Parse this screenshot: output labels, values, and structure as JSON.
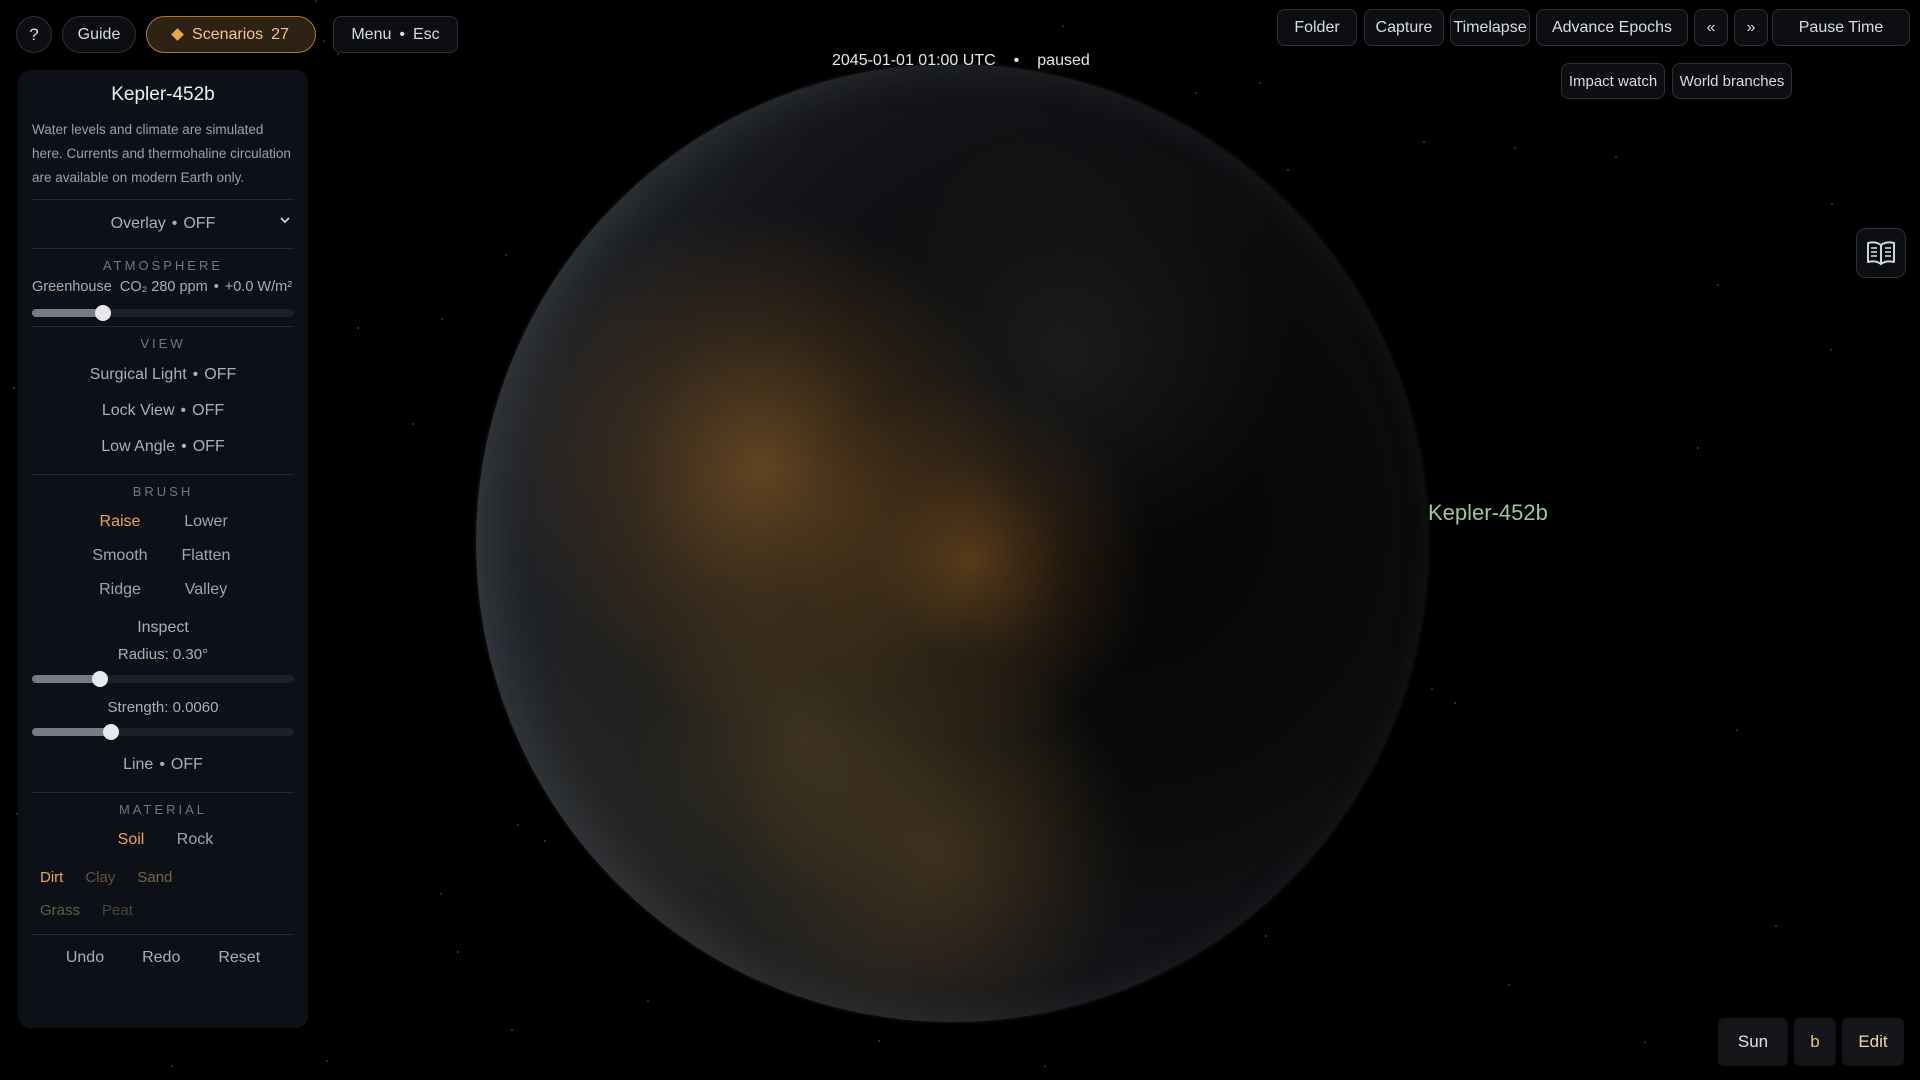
{
  "topbar": {
    "help_label": "?",
    "guide_label": "Guide",
    "scenarios_label": "Scenarios",
    "scenarios_count": "27",
    "menu_label": "Menu",
    "menu_key": "Esc",
    "folder_label": "Folder",
    "capture_label": "Capture",
    "timelapse_label": "Timelapse",
    "advance_label": "Advance Epochs",
    "prev_label": "«",
    "next_label": "»",
    "pause_label": "Pause Time",
    "impact_label": "Impact watch",
    "branches_label": "World branches",
    "sep": "•"
  },
  "time": {
    "datetime": "2045-01-01 01:00 UTC",
    "state": "paused"
  },
  "planet": {
    "label": "Kepler-452b"
  },
  "panel": {
    "title": "Kepler-452b",
    "description": "Water levels and climate are simulated here. Currents and thermohaline circulation are available on modern Earth only.",
    "overlay": {
      "label": "Overlay",
      "value": "OFF"
    },
    "atmosphere": {
      "heading": "ATMOSPHERE",
      "label": "Greenhouse",
      "co2": "CO₂ 280 ppm",
      "forcing": "+0.0 W/m²",
      "slider_fraction": 0.27
    },
    "view": {
      "heading": "VIEW",
      "surgical": {
        "label": "Surgical Light",
        "value": "OFF"
      },
      "lock": {
        "label": "Lock View",
        "value": "OFF"
      },
      "low": {
        "label": "Low Angle",
        "value": "OFF"
      }
    },
    "brush": {
      "heading": "BRUSH",
      "raise": "Raise",
      "lower": "Lower",
      "smooth": "Smooth",
      "flatten": "Flatten",
      "ridge": "Ridge",
      "valley": "Valley",
      "inspect": "Inspect",
      "radius_label": "Radius: 0.30°",
      "radius_fraction": 0.26,
      "strength_label": "Strength: 0.0060",
      "strength_fraction": 0.3,
      "line": {
        "label": "Line",
        "value": "OFF"
      }
    },
    "material": {
      "heading": "MATERIAL",
      "soil": "Soil",
      "rock": "Rock",
      "dirt": "Dirt",
      "clay": "Clay",
      "sand": "Sand",
      "grass": "Grass",
      "peat": "Peat"
    },
    "undo": "Undo",
    "redo": "Redo",
    "reset": "Reset"
  },
  "bottom": {
    "sun": "Sun",
    "b": "b",
    "edit": "Edit"
  },
  "colors": {
    "accent": "#e6a84e",
    "dirt": "#e6a84e",
    "clay": "#6b4f3a",
    "sand": "#7a6642",
    "grass": "#4d6b3c",
    "peat": "#4a4436",
    "planet_label": "#9ec49a"
  },
  "icons": {
    "scenario": "diamond-icon",
    "overlay": "chevron-down-icon",
    "guide_book": "open-book-icon"
  }
}
